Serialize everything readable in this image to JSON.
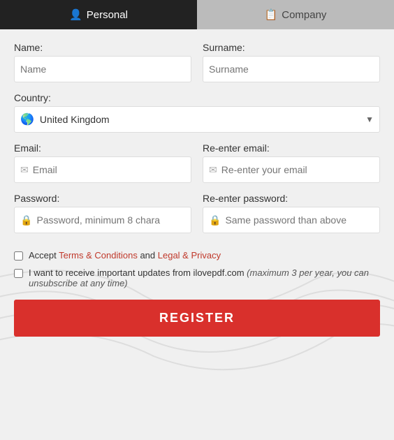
{
  "tabs": {
    "personal": {
      "label": "Personal",
      "icon": "👤",
      "active": true
    },
    "company": {
      "label": "Company",
      "icon": "🏢",
      "active": false
    }
  },
  "form": {
    "name_label": "Name:",
    "name_placeholder": "Name",
    "surname_label": "Surname:",
    "surname_placeholder": "Surname",
    "country_label": "Country:",
    "country_value": "United Kingdom",
    "email_label": "Email:",
    "email_placeholder": "Email",
    "reenter_email_label": "Re-enter email:",
    "reenter_email_placeholder": "Re-enter your email",
    "password_label": "Password:",
    "password_placeholder": "Password, minimum 8 chara",
    "reenter_password_label": "Re-enter password:",
    "reenter_password_placeholder": "Same password than above"
  },
  "checkboxes": {
    "terms_text_before": "Accept ",
    "terms_link1": "Terms & Conditions",
    "terms_text_middle": " and ",
    "terms_link2": "Legal & Privacy",
    "updates_text": "I want to receive important updates from ilovepdf.com ",
    "updates_italic": "(maximum 3 per year, you can unsubscribe at any time)"
  },
  "register_button": "REGISTER",
  "colors": {
    "active_tab": "#222222",
    "inactive_tab": "#bbbbbb",
    "register_btn": "#d9302c",
    "link_color": "#c0392b"
  }
}
